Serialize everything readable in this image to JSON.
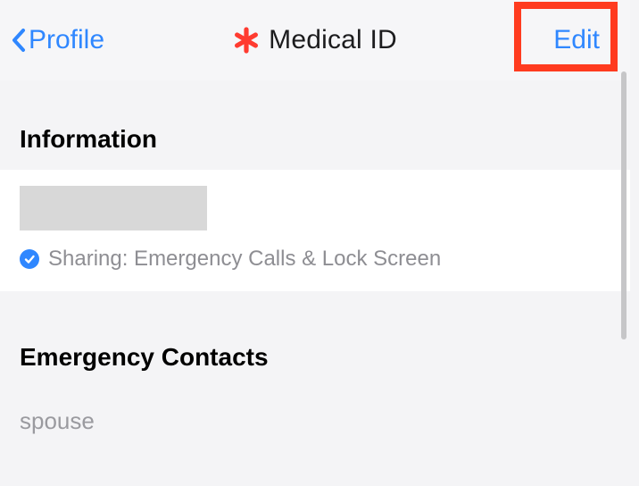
{
  "nav": {
    "back_label": "Profile",
    "title": "Medical ID",
    "edit_label": "Edit"
  },
  "sections": {
    "information": {
      "header": "Information",
      "sharing_text": "Sharing: Emergency Calls & Lock Screen"
    },
    "emergency_contacts": {
      "header": "Emergency Contacts",
      "items": [
        {
          "relation": "spouse"
        }
      ]
    }
  },
  "colors": {
    "accent": "#2f87ff",
    "medical_red": "#ff3b30",
    "highlight": "#ff3b1f",
    "muted": "#8e8e93"
  }
}
